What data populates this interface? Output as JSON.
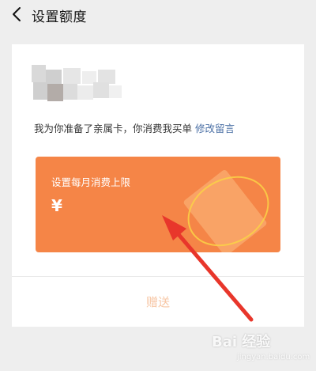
{
  "nav": {
    "title": "设置额度",
    "back_icon": "chevron-left-icon"
  },
  "card": {
    "message": "我为你准备了亲属卡，你消费我买单",
    "edit_link": "修改留言",
    "limit_card": {
      "label": "设置每月消费上限",
      "currency_symbol": "¥",
      "background_color": "#f58547"
    },
    "gift_button": "赠送"
  },
  "watermark": {
    "text": "Bai 经验",
    "subtext": "jingyan.baidu.com"
  },
  "annotation": {
    "arrow_color": "#e8362b"
  }
}
